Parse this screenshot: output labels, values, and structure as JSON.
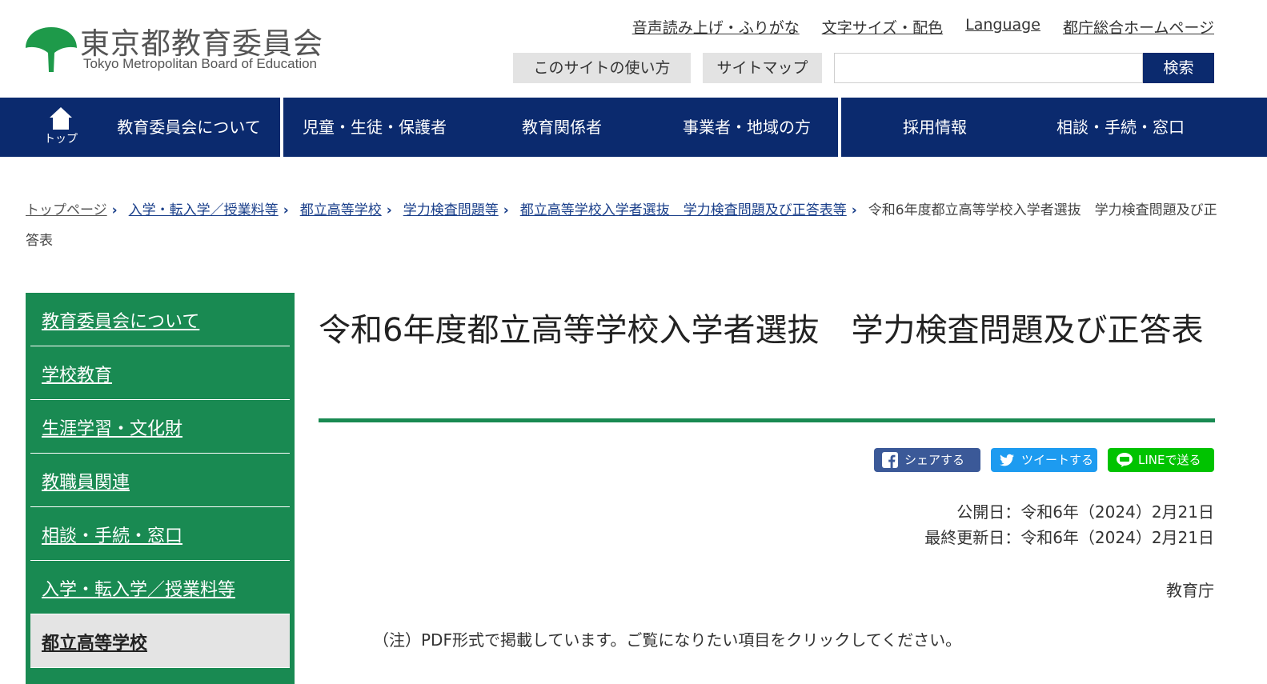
{
  "header": {
    "logo_ja": "東京都教育委員会",
    "logo_en": "Tokyo Metropolitan Board of Education",
    "util_links": [
      "音声読み上げ・ふりがな",
      "文字サイズ・配色",
      "Language",
      "都庁総合ホームページ"
    ],
    "usage_button": "このサイトの使い方",
    "sitemap_button": "サイトマップ",
    "search_value": "",
    "search_button": "検索"
  },
  "gnav": {
    "home_label": "トップ",
    "items": [
      "教育委員会について",
      "児童・生徒・保護者",
      "教育関係者",
      "事業者・地域の方",
      "採用情報",
      "相談・手続・窓口"
    ]
  },
  "breadcrumb": {
    "items": [
      "トップページ",
      "入学・転入学／授業料等",
      "都立高等学校",
      "学力検査問題等",
      "都立高等学校入学者選抜　学力検査問題及び正答表等"
    ],
    "current": "令和6年度都立高等学校入学者選抜　学力検査問題及び正答表"
  },
  "sidenav": {
    "items": [
      "教育委員会について",
      "学校教育",
      "生涯学習・文化財",
      "教職員関連",
      "相談・手続・窓口",
      "入学・転入学／授業料等",
      "都立高等学校"
    ]
  },
  "main": {
    "title": "令和6年度都立高等学校入学者選抜　学力検査問題及び正答表",
    "share_fb": "シェアする",
    "share_tw": "ツイートする",
    "share_line": "LINEで送る",
    "published": "公開日：令和6年（2024）2月21日",
    "updated": "最終更新日：令和6年（2024）2月21日",
    "org": "教育庁",
    "note": "（注）PDF形式で掲載しています。ご覧になりたい項目をクリックしてください。"
  },
  "colors": {
    "brand_green": "#198a52",
    "nav_navy": "#0b2a6e",
    "facebook": "#3b5998",
    "twitter": "#1d9bf0",
    "line": "#00c300"
  }
}
